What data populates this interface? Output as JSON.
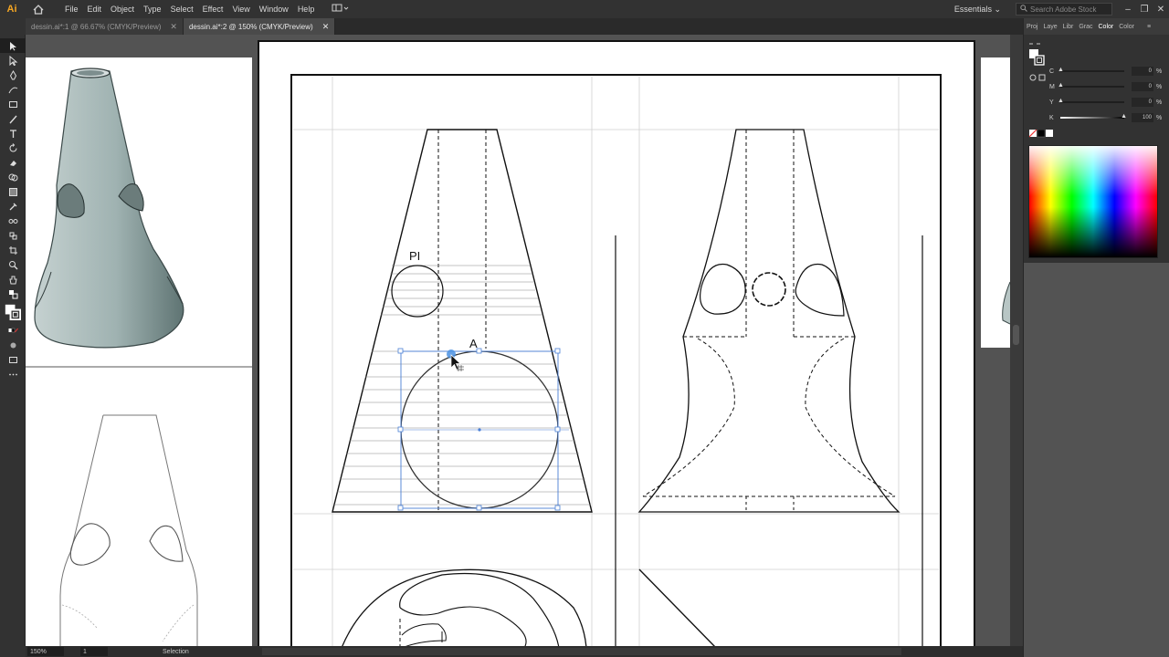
{
  "app": {
    "logo": "Ai"
  },
  "menu": {
    "items": [
      "File",
      "Edit",
      "Object",
      "Type",
      "Select",
      "Effect",
      "View",
      "Window",
      "Help"
    ]
  },
  "workspace": {
    "label": "Essentials"
  },
  "search": {
    "placeholder": "Search Adobe Stock"
  },
  "tabs": [
    {
      "label": "dessin.ai*:1 @ 66.67% (CMYK/Preview)",
      "active": false
    },
    {
      "label": "dessin.ai*:2 @ 150% (CMYK/Preview)",
      "active": true
    }
  ],
  "drawing": {
    "label_pi": "PI",
    "label_a": "A"
  },
  "panel": {
    "tabs": [
      "Proj",
      "Laye",
      "Libr",
      "Grac",
      "Color",
      "Color"
    ],
    "sliders": [
      {
        "label": "C",
        "value": "0",
        "pct": "%"
      },
      {
        "label": "M",
        "value": "0",
        "pct": "%"
      },
      {
        "label": "Y",
        "value": "0",
        "pct": "%"
      },
      {
        "label": "K",
        "value": "100",
        "pct": "%"
      }
    ]
  },
  "status": {
    "zoom": "150%",
    "page": "1",
    "tool": "Selection"
  },
  "colors": {
    "selection": "#4a7fd6",
    "ui_dark": "#323232",
    "canvas": "#535353"
  }
}
